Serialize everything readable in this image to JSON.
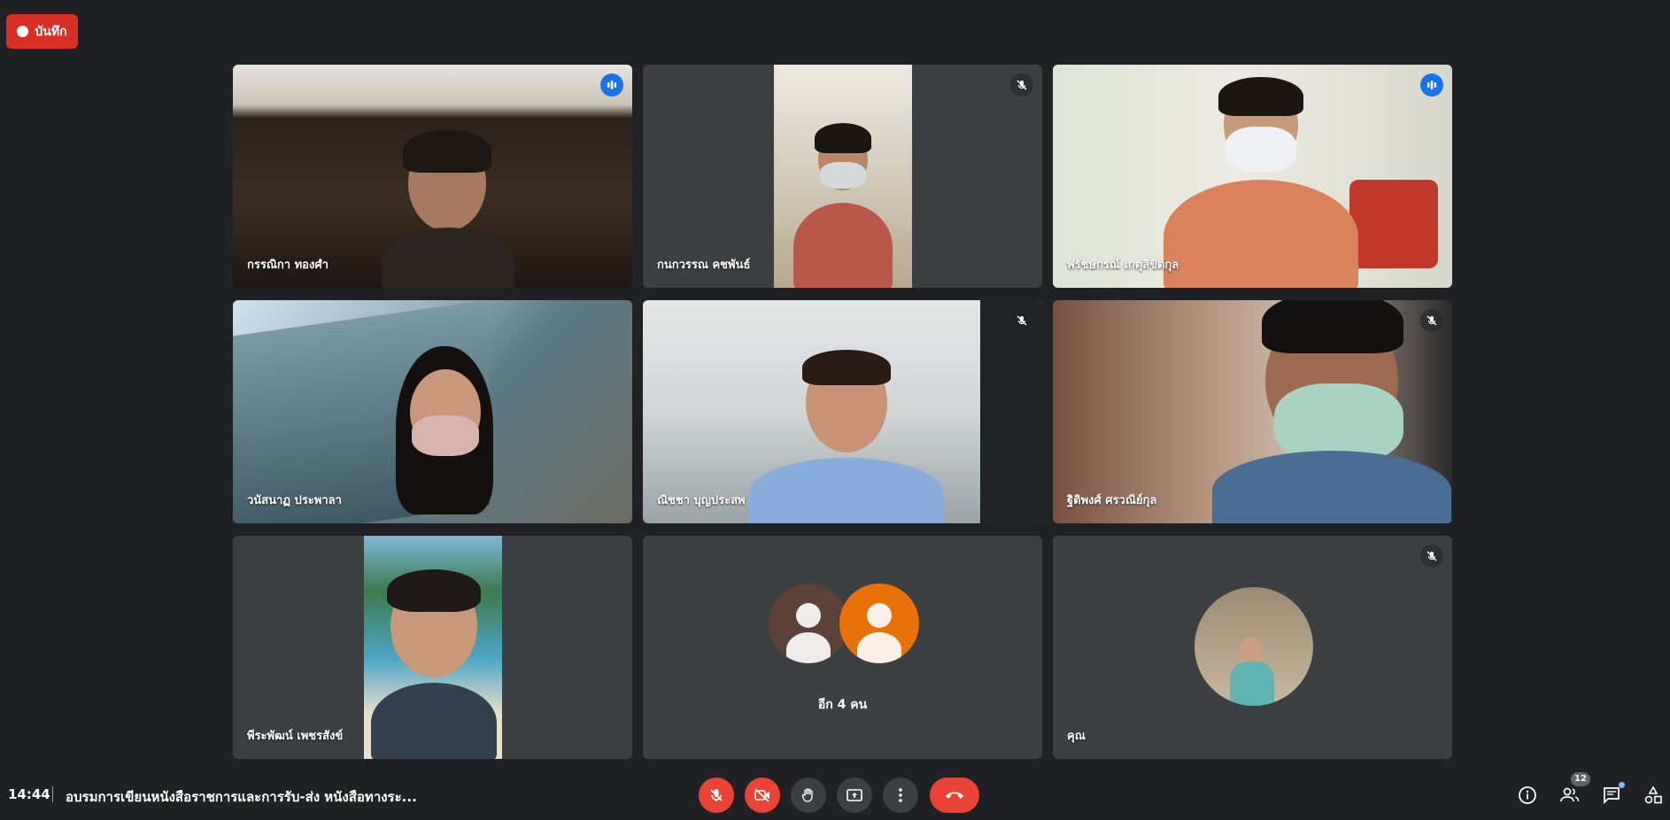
{
  "recording": {
    "label": "บันทึก"
  },
  "tiles": [
    {
      "name": "กรรณิกา ทองศำ",
      "status": "speaking"
    },
    {
      "name": "กนกวรรณ คชพันธ์",
      "status": "muted"
    },
    {
      "name": "พรัชษกรณ์ เกตุลิขิตกุล",
      "status": "speaking"
    },
    {
      "name": "วนัสนาฏ ประพาลา",
      "status": "none"
    },
    {
      "name": "ณิชชา บุญประสพ",
      "status": "muted"
    },
    {
      "name": "ฐิติพงศ์ ศรวณีย์กุล",
      "status": "muted"
    },
    {
      "name": "พีระพัฒน์ เพชรสังข์",
      "status": "none"
    },
    {
      "name": "อีก 4 คน",
      "status": "none"
    },
    {
      "name": "คุณ",
      "status": "muted"
    }
  ],
  "bottom_bar": {
    "time": "14:44",
    "meeting_title": "อบรมการเขียนหนังสือราชการและการรับ-ส่ง หนังสือทางระ...",
    "participant_count": "12"
  },
  "colors": {
    "background": "#202124",
    "tile": "#3c4043",
    "speaking_blue": "#1a73e8",
    "end_red": "#ea4335",
    "avatar_orange": "#e8710a",
    "avatar_brown": "#5d4037"
  },
  "icons": {
    "mic_off": "mic-off-icon",
    "camera_off": "videocam-off-icon",
    "raise_hand": "hand-icon",
    "present": "present-screen-icon",
    "more": "more-vert-icon",
    "end_call": "call-end-icon",
    "info": "info-icon",
    "people": "people-icon",
    "chat": "chat-icon",
    "activities": "activities-icon"
  }
}
